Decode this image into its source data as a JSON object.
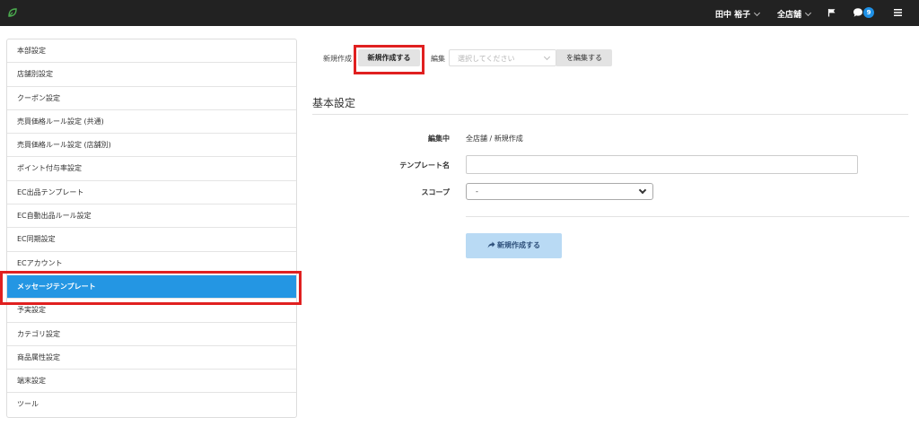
{
  "topbar": {
    "user_name": "田中 裕子",
    "store_selector": "全店舗",
    "notification_count": "9",
    "colors": {
      "bg": "#222222",
      "badge": "#1e90e6",
      "logo": "#4caf50"
    },
    "icons": [
      "leaf-logo-icon",
      "flag-icon",
      "chat-icon",
      "hamburger-menu-icon"
    ]
  },
  "sidebar": {
    "items": [
      {
        "label": "本部設定"
      },
      {
        "label": "店舗別設定"
      },
      {
        "label": "クーポン設定"
      },
      {
        "label": "売買価格ルール設定 (共通)"
      },
      {
        "label": "売買価格ルール設定 (店舗別)"
      },
      {
        "label": "ポイント付与率設定"
      },
      {
        "label": "EC出品テンプレート"
      },
      {
        "label": "EC自動出品ルール設定"
      },
      {
        "label": "EC同期設定"
      },
      {
        "label": "ECアカウント"
      },
      {
        "label": "メッセージテンプレート",
        "active": true
      },
      {
        "label": "予実設定"
      },
      {
        "label": "カテゴリ設定"
      },
      {
        "label": "商品属性設定"
      },
      {
        "label": "端末設定"
      },
      {
        "label": "ツール"
      }
    ],
    "active_color": "#2496e3"
  },
  "toolbar": {
    "new_label": "新規作成",
    "create_button": "新規作成する",
    "edit_label": "編集",
    "template_select_placeholder": "選択してください",
    "edit_button": "を編集する"
  },
  "form": {
    "section_title": "基本設定",
    "editing_label": "編集中",
    "editing_value": "全店舗 / 新規作成",
    "template_name_label": "テンプレート名",
    "template_name_value": "",
    "scope_label": "スコープ",
    "scope_value": "-",
    "submit_button": "新規作成する",
    "submit_color": "#b9daf4"
  },
  "highlight_color": "#e02020"
}
